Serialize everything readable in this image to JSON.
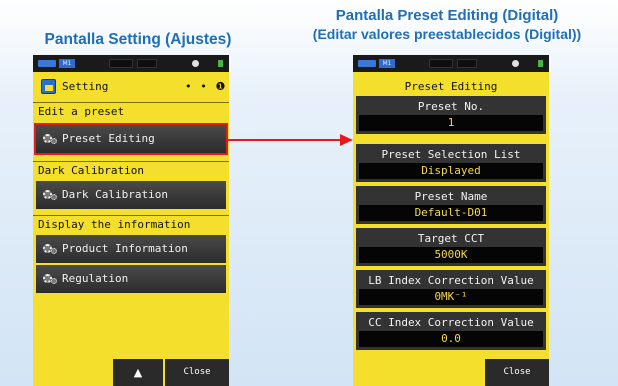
{
  "captions": {
    "left": "Pantalla Setting (Ajustes)",
    "right_line1": "Pantalla Preset Editing (Digital)",
    "right_line2": "(Editar valores preestablecidos (Digital))"
  },
  "status_bar": {
    "tag": "M1"
  },
  "left_screen": {
    "title": "Setting",
    "title_indicator": "• • ❶",
    "sections": [
      {
        "label": "Edit a preset",
        "buttons": [
          "Preset Editing"
        ]
      },
      {
        "label": "Dark Calibration",
        "buttons": [
          "Dark Calibration"
        ]
      },
      {
        "label": "Display the information",
        "buttons": [
          "Product Information",
          "Regulation"
        ]
      }
    ],
    "bottom": {
      "up": "▲",
      "close": "Close"
    }
  },
  "right_screen": {
    "title": "Preset Editing",
    "fields": [
      {
        "label": "Preset No.",
        "value": "1"
      },
      {
        "label": "Preset Selection List",
        "value": "Displayed"
      },
      {
        "label": "Preset Name",
        "value": "Default-D01"
      },
      {
        "label": "Target CCT",
        "value": "5000K"
      },
      {
        "label": "LB Index Correction Value",
        "value": "0MK⁻¹"
      },
      {
        "label": "CC Index Correction Value",
        "value": "0.0"
      }
    ],
    "bottom": {
      "close": "Close"
    }
  },
  "colors": {
    "screen_bg": "#f4e02c",
    "caption": "#1f6fb7",
    "arrow": "#e21b1b",
    "value_text": "#f6d84a"
  }
}
